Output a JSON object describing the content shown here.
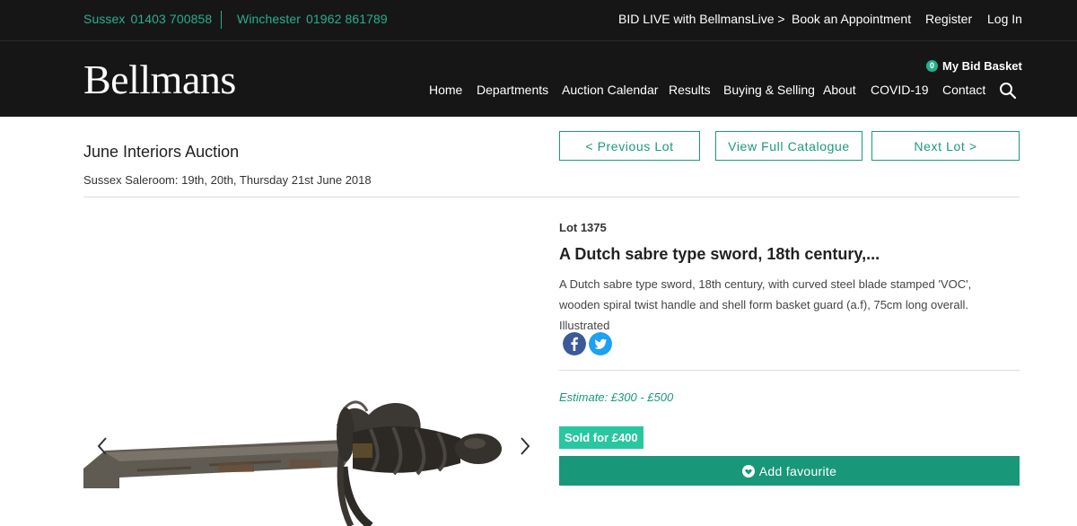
{
  "topbar": {
    "sussex_label": "Sussex",
    "sussex_phone": "01403 700858",
    "winchester_label": "Winchester",
    "winchester_phone": "01962 861789",
    "bid_live": "BID LIVE with BellmansLive >",
    "book": "Book an Appointment",
    "register": "Register",
    "login": "Log In"
  },
  "header": {
    "logo": "Bellmans",
    "basket_count": "0",
    "basket_label": "My Bid Basket",
    "nav": [
      "Home",
      "Departments",
      "Auction Calendar",
      "Results",
      "Buying & Selling",
      "About",
      "COVID-19",
      "Contact"
    ]
  },
  "auction": {
    "title": "June Interiors Auction",
    "saleroom": "Sussex Saleroom: 19th, 20th, Thursday 21st June 2018"
  },
  "lot_nav": {
    "previous": "< Previous Lot",
    "catalogue": "View Full Catalogue",
    "next": "Next Lot >"
  },
  "lot": {
    "number": "Lot 1375",
    "title": "A Dutch sabre type sword, 18th century,...",
    "description": "A Dutch sabre type sword, 18th century, with curved steel blade stamped 'VOC', wooden spiral twist handle and shell form basket guard (a.f), 75cm long overall.",
    "illustrated": "Illustrated",
    "estimate": "Estimate: £300 - £500",
    "sold": "Sold for £400",
    "favourite": "Add favourite"
  },
  "icons": {
    "search": "search-icon",
    "facebook": "facebook-icon",
    "twitter": "twitter-icon",
    "heart": "heart-icon",
    "prev_image": "chevron-left-icon",
    "next_image": "chevron-right-icon"
  },
  "colors": {
    "brand_green": "#1a9a7a",
    "header_bg": "#161616",
    "sold_badge": "#28c79f"
  }
}
